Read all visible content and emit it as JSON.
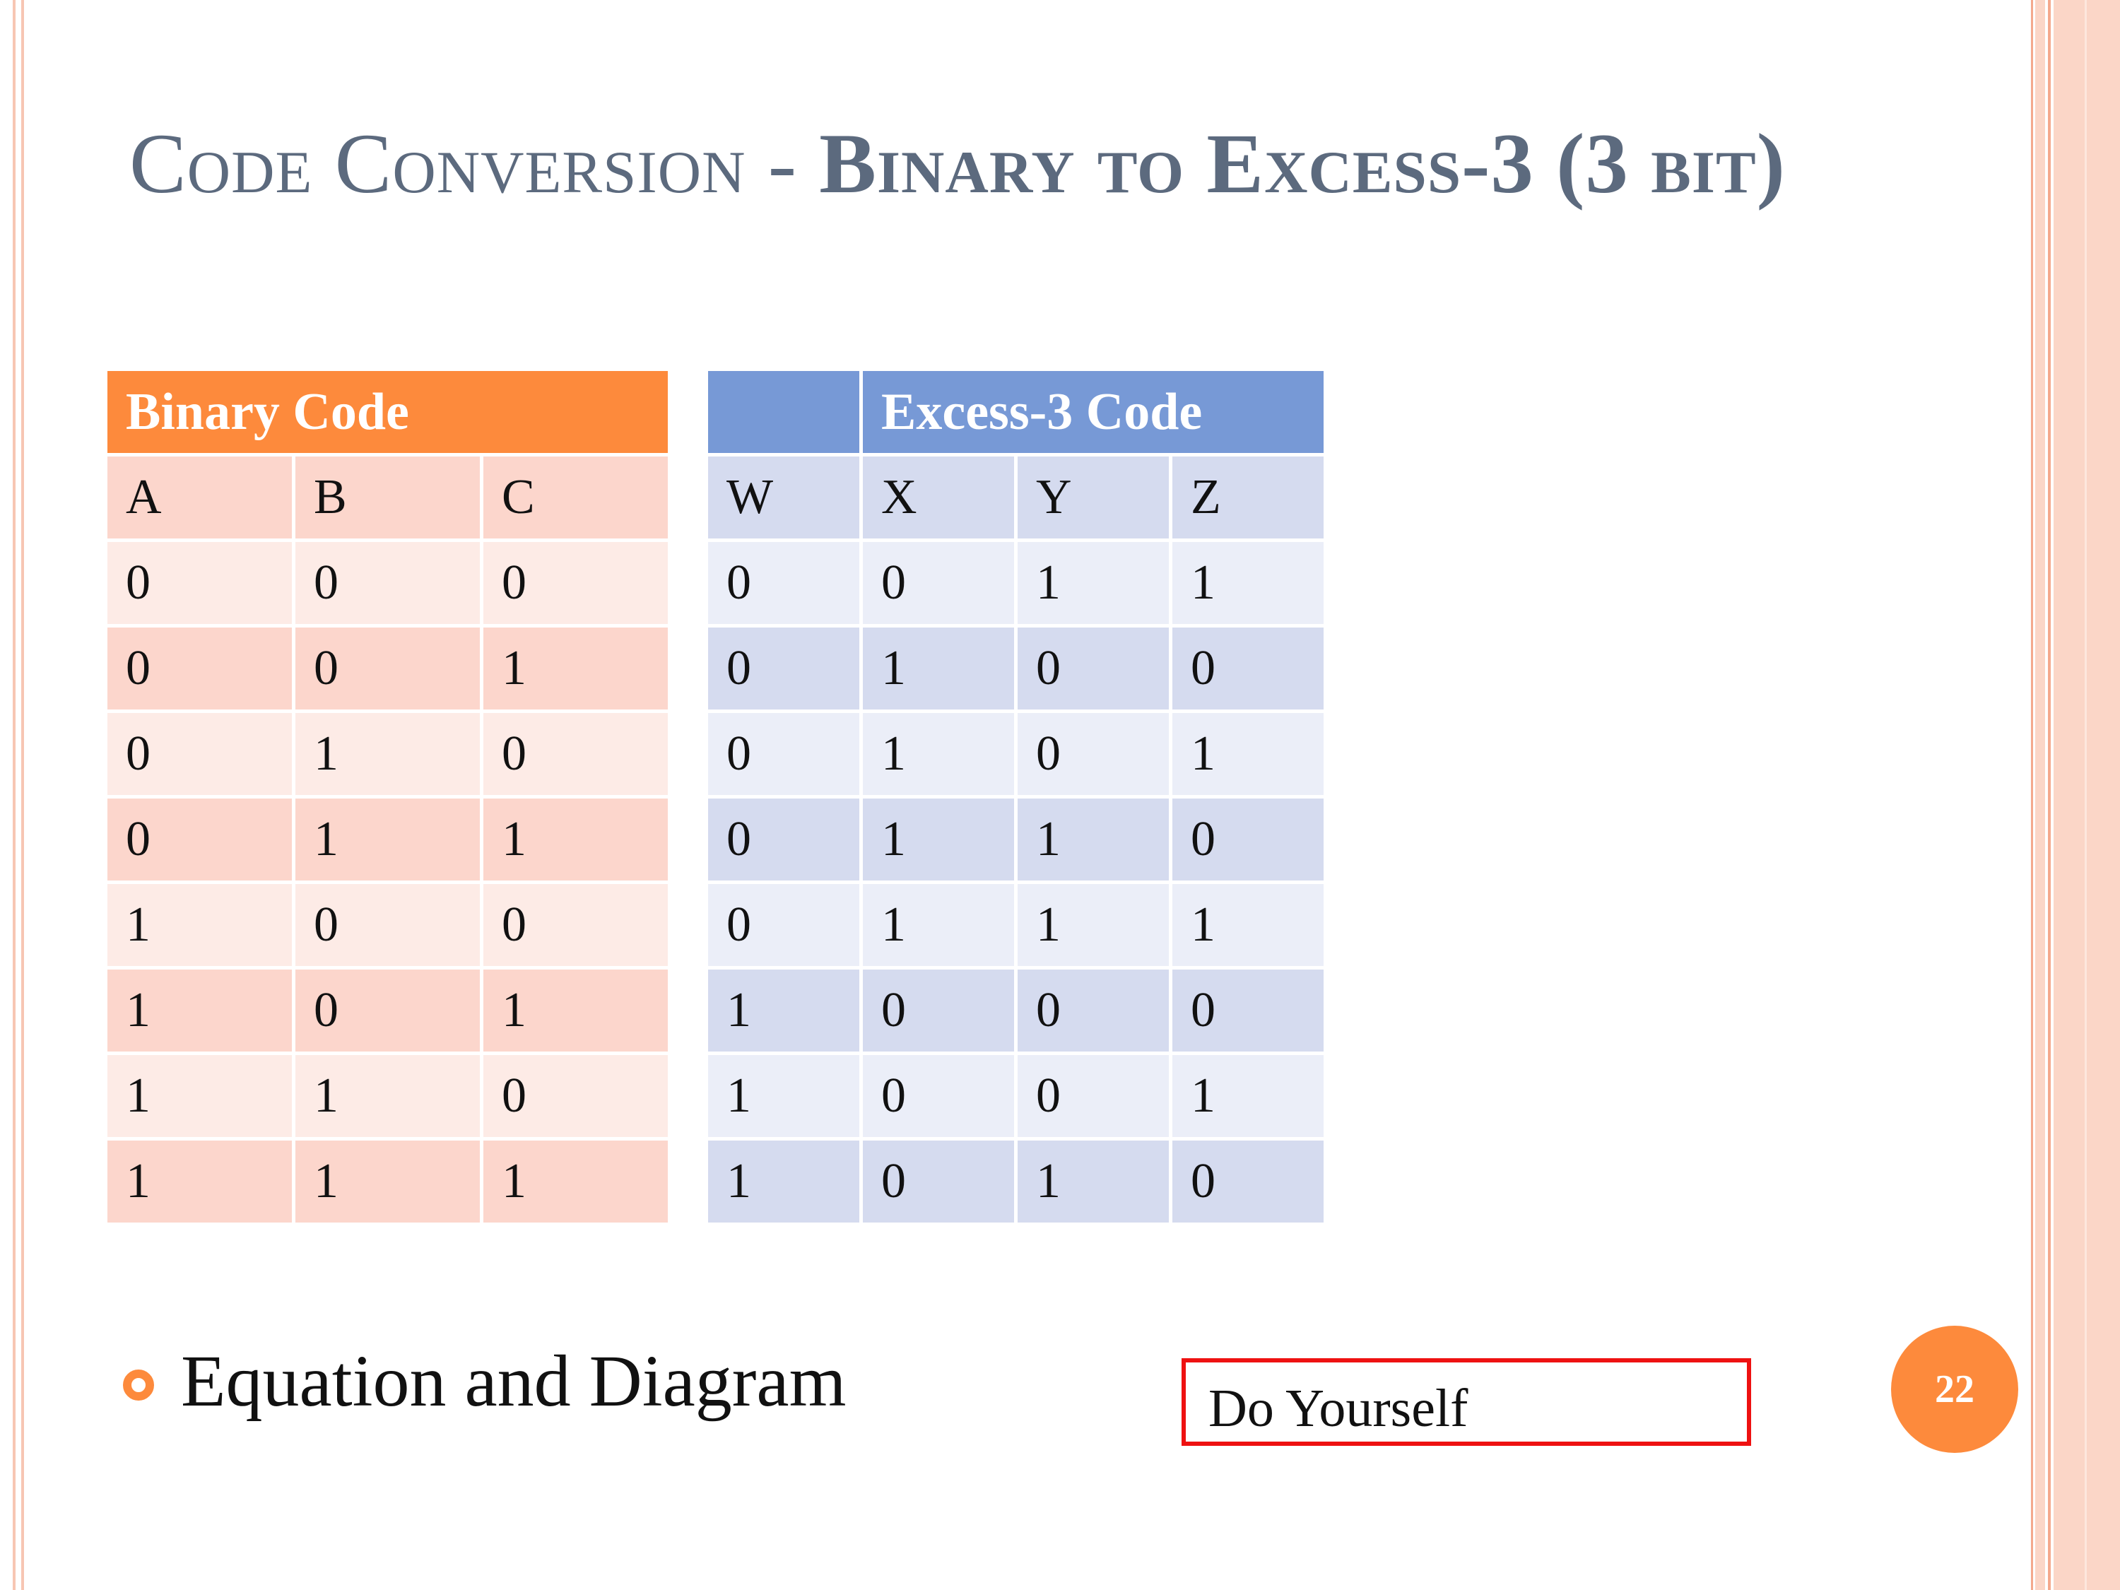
{
  "slide": {
    "title_normal": "Code Conversion - ",
    "title_bold": "Binary to Excess-3 (3 bit)",
    "page_number": "22"
  },
  "binary_table": {
    "header": "Binary Code",
    "columns": [
      "A",
      "B",
      "C"
    ],
    "rows": [
      [
        "0",
        "0",
        "0"
      ],
      [
        "0",
        "0",
        "1"
      ],
      [
        "0",
        "1",
        "0"
      ],
      [
        "0",
        "1",
        "1"
      ],
      [
        "1",
        "0",
        "0"
      ],
      [
        "1",
        "0",
        "1"
      ],
      [
        "1",
        "1",
        "0"
      ],
      [
        "1",
        "1",
        "1"
      ]
    ]
  },
  "excess_table": {
    "header": "Excess-3 Code",
    "columns": [
      "W",
      "X",
      "Y",
      "Z"
    ],
    "rows": [
      [
        "0",
        "0",
        "1",
        "1"
      ],
      [
        "0",
        "1",
        "0",
        "0"
      ],
      [
        "0",
        "1",
        "0",
        "1"
      ],
      [
        "0",
        "1",
        "1",
        "0"
      ],
      [
        "0",
        "1",
        "1",
        "1"
      ],
      [
        "1",
        "0",
        "0",
        "0"
      ],
      [
        "1",
        "0",
        "0",
        "1"
      ],
      [
        "1",
        "0",
        "1",
        "0"
      ]
    ]
  },
  "bullet": {
    "text": "Equation and Diagram"
  },
  "note_box": {
    "text": "Do Yourself"
  },
  "colors": {
    "accent_orange": "#fd8a3c",
    "accent_blue": "#7799d6",
    "title_gray": "#5c6a7e",
    "note_border_red": "#ee1111"
  }
}
